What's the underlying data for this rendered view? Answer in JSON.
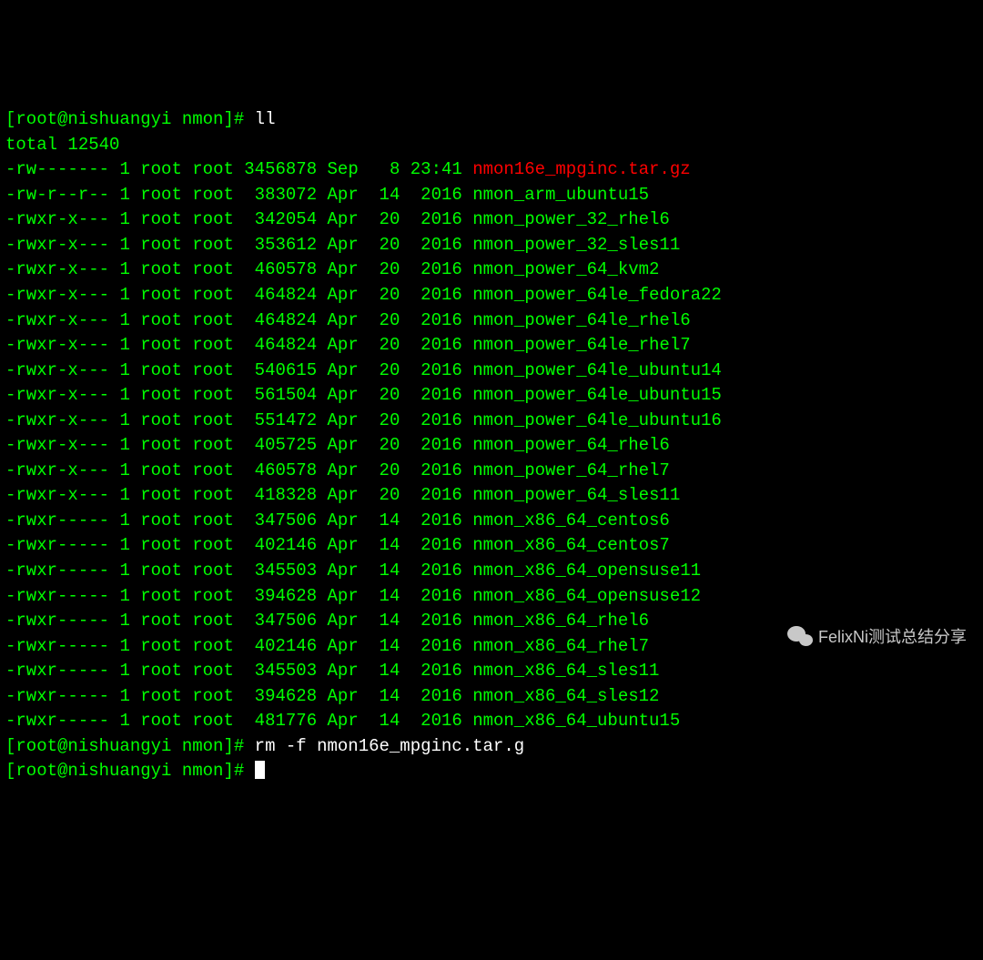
{
  "prompt1": {
    "bracket_open": "[",
    "user": "root@nishuangyi",
    "dir": " nmon",
    "bracket_close": "]",
    "hash": "# ",
    "cmd": "ll"
  },
  "total_line": "total 12540",
  "listing": [
    {
      "perms": "-rw-------",
      "links": "1",
      "owner": "root",
      "group": "root",
      "size": "3456878",
      "month": "Sep",
      "day": "  8",
      "time": "23:41",
      "name": "nmon16e_mpginc.tar.gz",
      "cls": "archive"
    },
    {
      "perms": "-rw-r--r--",
      "links": "1",
      "owner": "root",
      "group": "root",
      "size": " 383072",
      "month": "Apr",
      "day": " 14",
      "time": " 2016",
      "name": "nmon_arm_ubuntu15",
      "cls": "file"
    },
    {
      "perms": "-rwxr-x---",
      "links": "1",
      "owner": "root",
      "group": "root",
      "size": " 342054",
      "month": "Apr",
      "day": " 20",
      "time": " 2016",
      "name": "nmon_power_32_rhel6",
      "cls": "file"
    },
    {
      "perms": "-rwxr-x---",
      "links": "1",
      "owner": "root",
      "group": "root",
      "size": " 353612",
      "month": "Apr",
      "day": " 20",
      "time": " 2016",
      "name": "nmon_power_32_sles11",
      "cls": "file"
    },
    {
      "perms": "-rwxr-x---",
      "links": "1",
      "owner": "root",
      "group": "root",
      "size": " 460578",
      "month": "Apr",
      "day": " 20",
      "time": " 2016",
      "name": "nmon_power_64_kvm2",
      "cls": "file"
    },
    {
      "perms": "-rwxr-x---",
      "links": "1",
      "owner": "root",
      "group": "root",
      "size": " 464824",
      "month": "Apr",
      "day": " 20",
      "time": " 2016",
      "name": "nmon_power_64le_fedora22",
      "cls": "file"
    },
    {
      "perms": "-rwxr-x---",
      "links": "1",
      "owner": "root",
      "group": "root",
      "size": " 464824",
      "month": "Apr",
      "day": " 20",
      "time": " 2016",
      "name": "nmon_power_64le_rhel6",
      "cls": "file"
    },
    {
      "perms": "-rwxr-x---",
      "links": "1",
      "owner": "root",
      "group": "root",
      "size": " 464824",
      "month": "Apr",
      "day": " 20",
      "time": " 2016",
      "name": "nmon_power_64le_rhel7",
      "cls": "file"
    },
    {
      "perms": "-rwxr-x---",
      "links": "1",
      "owner": "root",
      "group": "root",
      "size": " 540615",
      "month": "Apr",
      "day": " 20",
      "time": " 2016",
      "name": "nmon_power_64le_ubuntu14",
      "cls": "file"
    },
    {
      "perms": "-rwxr-x---",
      "links": "1",
      "owner": "root",
      "group": "root",
      "size": " 561504",
      "month": "Apr",
      "day": " 20",
      "time": " 2016",
      "name": "nmon_power_64le_ubuntu15",
      "cls": "file"
    },
    {
      "perms": "-rwxr-x---",
      "links": "1",
      "owner": "root",
      "group": "root",
      "size": " 551472",
      "month": "Apr",
      "day": " 20",
      "time": " 2016",
      "name": "nmon_power_64le_ubuntu16",
      "cls": "file"
    },
    {
      "perms": "-rwxr-x---",
      "links": "1",
      "owner": "root",
      "group": "root",
      "size": " 405725",
      "month": "Apr",
      "day": " 20",
      "time": " 2016",
      "name": "nmon_power_64_rhel6",
      "cls": "file"
    },
    {
      "perms": "-rwxr-x---",
      "links": "1",
      "owner": "root",
      "group": "root",
      "size": " 460578",
      "month": "Apr",
      "day": " 20",
      "time": " 2016",
      "name": "nmon_power_64_rhel7",
      "cls": "file"
    },
    {
      "perms": "-rwxr-x---",
      "links": "1",
      "owner": "root",
      "group": "root",
      "size": " 418328",
      "month": "Apr",
      "day": " 20",
      "time": " 2016",
      "name": "nmon_power_64_sles11",
      "cls": "file"
    },
    {
      "perms": "-rwxr-----",
      "links": "1",
      "owner": "root",
      "group": "root",
      "size": " 347506",
      "month": "Apr",
      "day": " 14",
      "time": " 2016",
      "name": "nmon_x86_64_centos6",
      "cls": "file"
    },
    {
      "perms": "-rwxr-----",
      "links": "1",
      "owner": "root",
      "group": "root",
      "size": " 402146",
      "month": "Apr",
      "day": " 14",
      "time": " 2016",
      "name": "nmon_x86_64_centos7",
      "cls": "file"
    },
    {
      "perms": "-rwxr-----",
      "links": "1",
      "owner": "root",
      "group": "root",
      "size": " 345503",
      "month": "Apr",
      "day": " 14",
      "time": " 2016",
      "name": "nmon_x86_64_opensuse11",
      "cls": "file"
    },
    {
      "perms": "-rwxr-----",
      "links": "1",
      "owner": "root",
      "group": "root",
      "size": " 394628",
      "month": "Apr",
      "day": " 14",
      "time": " 2016",
      "name": "nmon_x86_64_opensuse12",
      "cls": "file"
    },
    {
      "perms": "-rwxr-----",
      "links": "1",
      "owner": "root",
      "group": "root",
      "size": " 347506",
      "month": "Apr",
      "day": " 14",
      "time": " 2016",
      "name": "nmon_x86_64_rhel6",
      "cls": "file"
    },
    {
      "perms": "-rwxr-----",
      "links": "1",
      "owner": "root",
      "group": "root",
      "size": " 402146",
      "month": "Apr",
      "day": " 14",
      "time": " 2016",
      "name": "nmon_x86_64_rhel7",
      "cls": "file"
    },
    {
      "perms": "-rwxr-----",
      "links": "1",
      "owner": "root",
      "group": "root",
      "size": " 345503",
      "month": "Apr",
      "day": " 14",
      "time": " 2016",
      "name": "nmon_x86_64_sles11",
      "cls": "file"
    },
    {
      "perms": "-rwxr-----",
      "links": "1",
      "owner": "root",
      "group": "root",
      "size": " 394628",
      "month": "Apr",
      "day": " 14",
      "time": " 2016",
      "name": "nmon_x86_64_sles12",
      "cls": "file"
    },
    {
      "perms": "-rwxr-----",
      "links": "1",
      "owner": "root",
      "group": "root",
      "size": " 481776",
      "month": "Apr",
      "day": " 14",
      "time": " 2016",
      "name": "nmon_x86_64_ubuntu15",
      "cls": "file"
    }
  ],
  "prompt2": {
    "bracket_open": "[",
    "user": "root@nishuangyi",
    "dir": " nmon",
    "bracket_close": "]",
    "hash": "# ",
    "cmd": "rm -f nmon16e_mpginc.tar.g"
  },
  "prompt3": {
    "bracket_open": "[",
    "user": "root@nishuangyi",
    "dir": " nmon",
    "bracket_close": "]",
    "hash": "# "
  },
  "watermark_text": "FelixNi测试总结分享"
}
